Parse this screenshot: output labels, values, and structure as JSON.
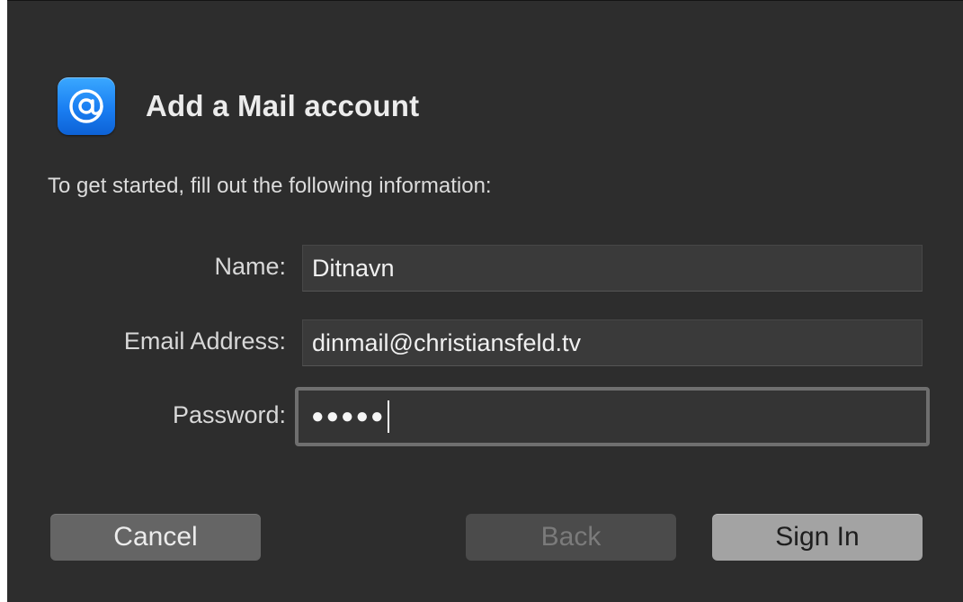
{
  "dialog": {
    "title": "Add a Mail account",
    "intro": "To get started, fill out the following information:",
    "app_icon": "at-sign-icon"
  },
  "form": {
    "name_label": "Name:",
    "name_value": "Ditnavn",
    "email_label": "Email Address:",
    "email_value": "dinmail@christiansfeld.tv",
    "password_label": "Password:",
    "password_masked": "●●●●●"
  },
  "buttons": {
    "cancel_label": "Cancel",
    "back_label": "Back",
    "signin_label": "Sign In"
  },
  "colors": {
    "background": "#2d2d2d",
    "accent": "#1a7ef2"
  }
}
